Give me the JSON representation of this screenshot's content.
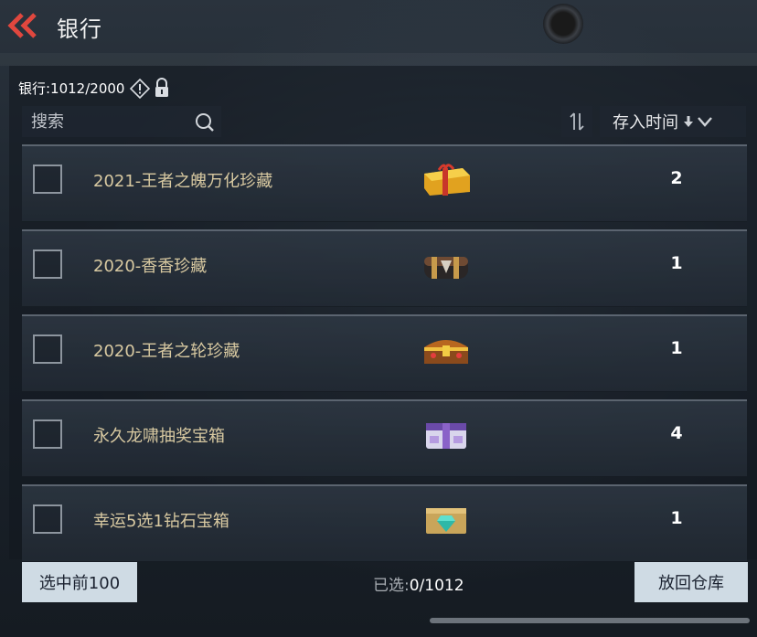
{
  "header": {
    "title": "银行"
  },
  "bank": {
    "label": "银行:1012/2000"
  },
  "search": {
    "placeholder": "搜索"
  },
  "sort": {
    "label": "存入时间"
  },
  "items": [
    {
      "name": "2021-王者之魄万化珍藏",
      "qty": "2",
      "icon": "gold-gift-chest-icon"
    },
    {
      "name": "2020-香香珍藏",
      "qty": "1",
      "icon": "dark-chest-icon"
    },
    {
      "name": "2020-王者之轮珍藏",
      "qty": "1",
      "icon": "gold-treasure-chest-icon"
    },
    {
      "name": "永久龙啸抽奖宝箱",
      "qty": "4",
      "icon": "purple-lottery-box-icon"
    },
    {
      "name": "幸运5选1钻石宝箱",
      "qty": "1",
      "icon": "diamond-chest-icon"
    }
  ],
  "footer": {
    "select_top_label": "选中前100",
    "selected_label": "已选:",
    "selected_value": "0/1012",
    "return_label": "放回仓库"
  },
  "colors": {
    "accent": "#e0473e",
    "item_name": "#d8c9a1",
    "button_bg": "#cfdbe4"
  }
}
